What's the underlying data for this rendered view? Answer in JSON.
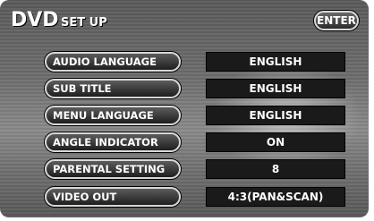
{
  "header": {
    "brand": "DVD",
    "title": "SET UP",
    "enter_label": "ENTER"
  },
  "settings": [
    {
      "label": "AUDIO LANGUAGE",
      "value": "ENGLISH"
    },
    {
      "label": "SUB TITLE",
      "value": "ENGLISH"
    },
    {
      "label": "MENU LANGUAGE",
      "value": "ENGLISH"
    },
    {
      "label": "ANGLE INDICATOR",
      "value": "ON"
    },
    {
      "label": "PARENTAL SETTING",
      "value": "8"
    },
    {
      "label": "VIDEO OUT",
      "value": "4:3(PAN&SCAN)"
    }
  ]
}
